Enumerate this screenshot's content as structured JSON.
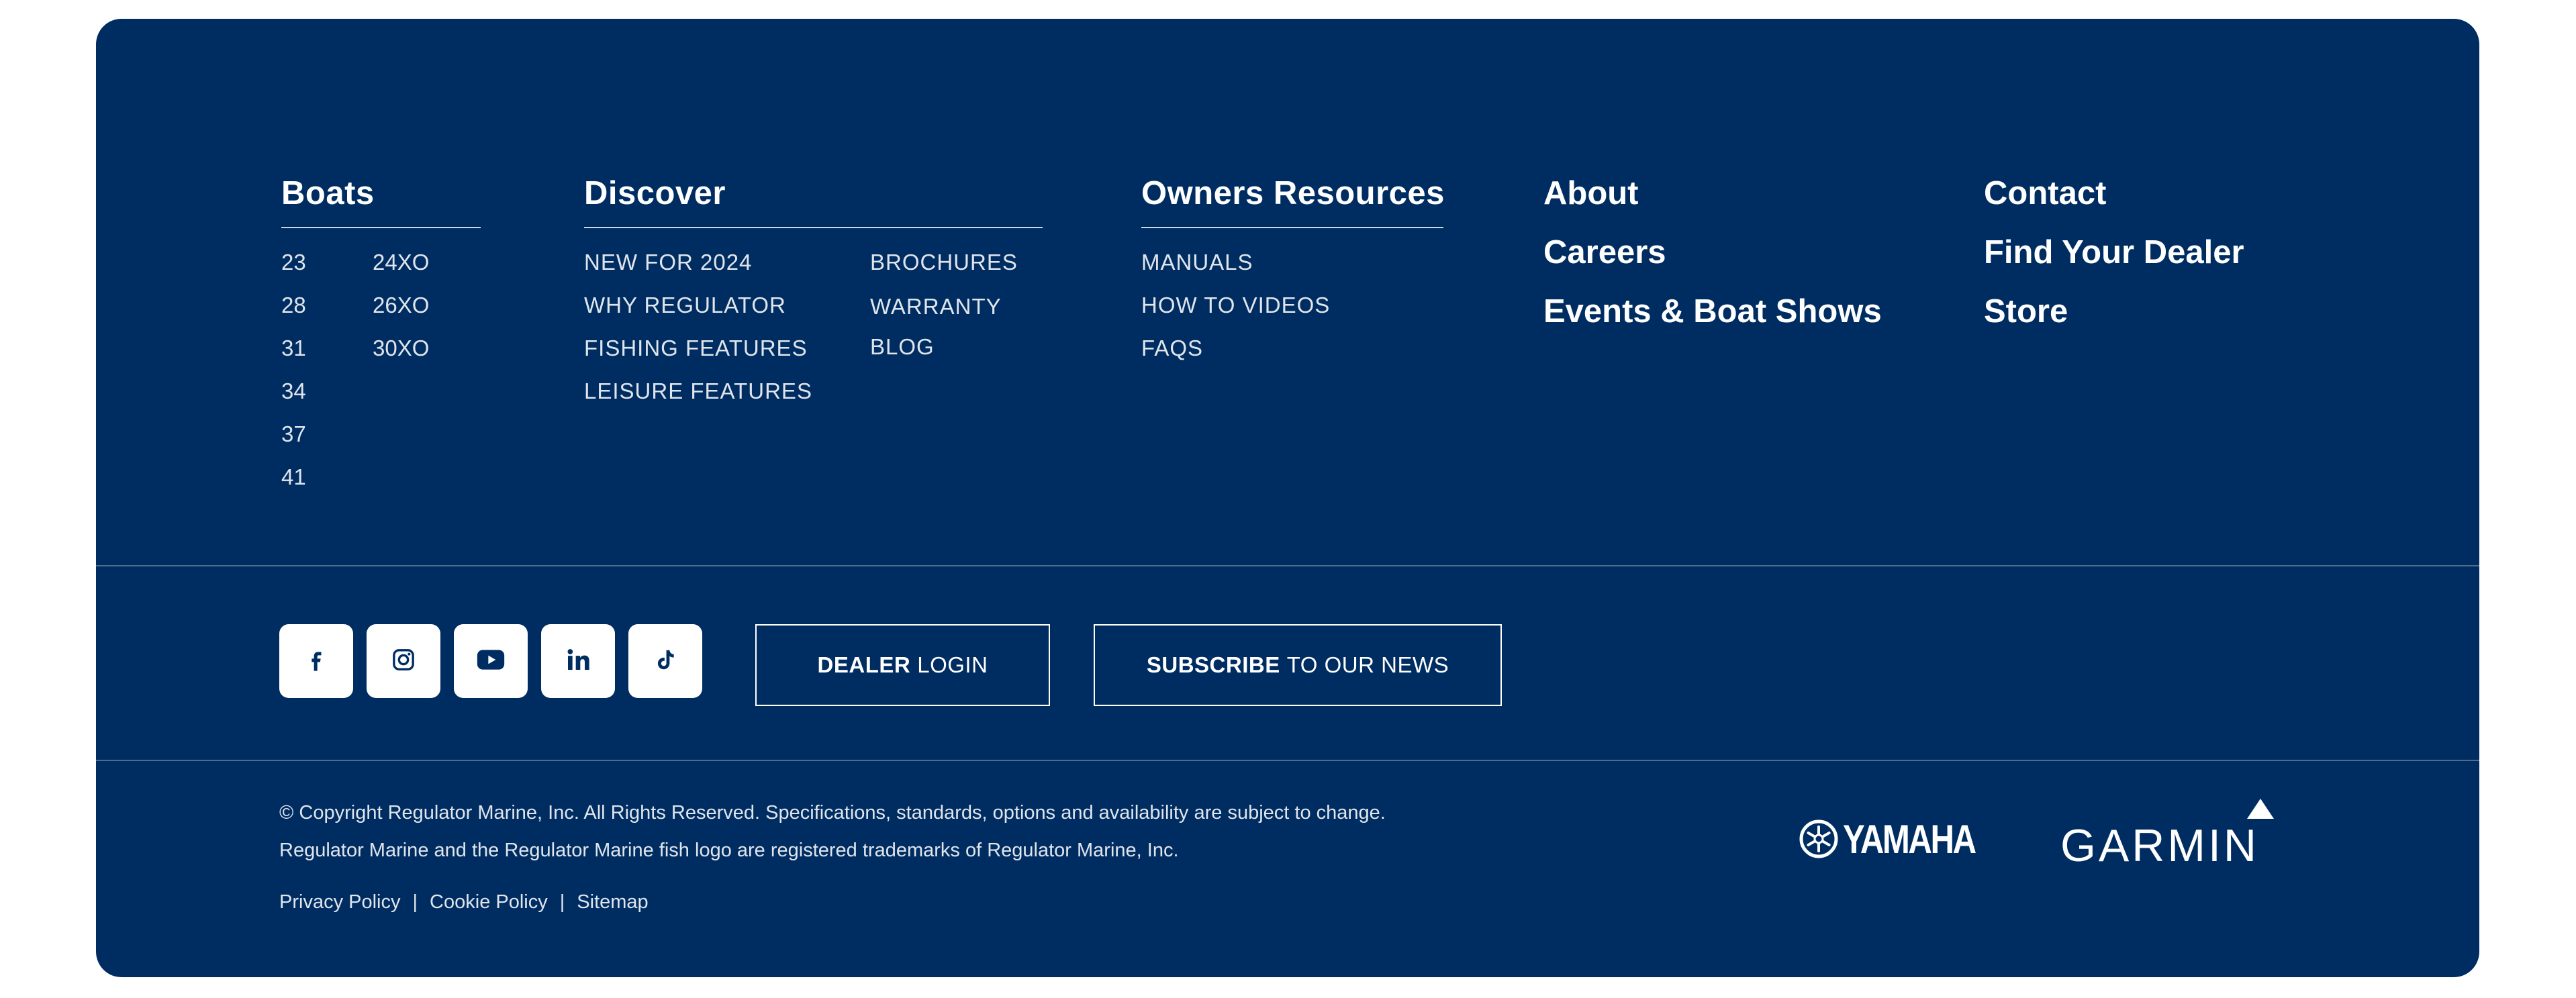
{
  "boats": {
    "title": "Boats",
    "col1": [
      "23",
      "28",
      "31",
      "34",
      "37",
      "41"
    ],
    "col2": [
      "24XO",
      "26XO",
      "30XO"
    ]
  },
  "discover": {
    "title": "Discover",
    "col1": [
      "NEW FOR 2024",
      "WHY REGULATOR",
      "FISHING FEATURES",
      "LEISURE FEATURES"
    ],
    "col2": [
      "BROCHURES",
      "WARRANTY",
      "BLOG"
    ]
  },
  "owners": {
    "title": "Owners Resources",
    "items": [
      "MANUALS",
      "HOW TO VIDEOS",
      "FAQS"
    ]
  },
  "about_links": [
    "About",
    "Careers",
    "Events & Boat Shows"
  ],
  "contact_links": [
    "Contact",
    "Find Your Dealer",
    "Store"
  ],
  "social": {
    "icons": [
      "facebook-icon",
      "instagram-icon",
      "youtube-icon",
      "linkedin-icon",
      "tiktok-icon"
    ]
  },
  "buttons": {
    "dealer_bold": "DEALER",
    "dealer_light": "LOGIN",
    "subscribe_bold": "SUBSCRIBE",
    "subscribe_light": "TO OUR NEWS"
  },
  "legal": {
    "line1": "© Copyright Regulator Marine, Inc. All Rights Reserved. Specifications, standards, options and availability are subject to change.",
    "line2": "Regulator Marine and the Regulator Marine fish logo are registered trademarks of Regulator Marine, Inc.",
    "links": [
      "Privacy Policy",
      "Cookie Policy",
      "Sitemap"
    ],
    "separator": "|"
  },
  "partners": {
    "yamaha": "YAMAHA",
    "garmin": "GARMIN"
  },
  "colors": {
    "background": "#002d61",
    "text": "#ffffff"
  }
}
